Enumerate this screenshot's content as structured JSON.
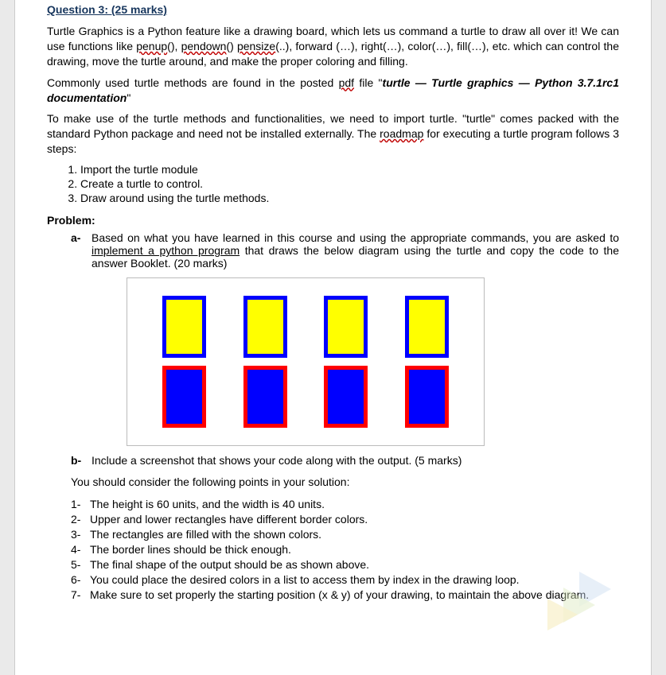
{
  "heading": "Question 3: (25 marks)",
  "para1_pre": "Turtle Graphics is a Python feature like a drawing board, which lets us command a turtle to draw all over it! We can use functions like ",
  "squig1": "penup",
  "para1_a": "(), ",
  "squig2": "pendown",
  "para1_b": "() ",
  "squig3": "pensize",
  "para1_c": "(..), forward (…), right(…), color(…), fill(…), etc. which can control the drawing, move the turtle around, and make the proper coloring and filling.",
  "para2_pre": "Commonly used turtle methods are found in the posted ",
  "squig4": "pdf",
  "para2_mid": " file \"",
  "para2_bold": "turtle — Turtle graphics — Python 3.7.1rc1 documentation",
  "para2_end": "\"",
  "para3_pre": "To make use of the turtle methods and functionalities, we need to import turtle. \"turtle\" comes packed with the standard Python package and need not be installed externally. The ",
  "squig5": "roadmap",
  "para3_end": " for executing a turtle program follows 3 steps:",
  "steps": [
    "Import the turtle module",
    "Create a turtle to control.",
    "Draw around using the turtle methods."
  ],
  "problem_label": "Problem:",
  "item_a_marker": "a-",
  "item_a_pre": "Based on what you have learned in this course and using the appropriate commands, you are asked to ",
  "item_a_underline": "implement a python program",
  "item_a_post": " that draws the below diagram using the turtle and copy the code to the answer Booklet. (20 marks)",
  "item_b_marker": "b-",
  "item_b": "Include a screenshot that shows your code along with the output. (5 marks)",
  "notes_intro": "You should consider the following points in your solution:",
  "notes": [
    "The height is 60 units, and the width is 40 units.",
    "Upper and lower rectangles have different border colors.",
    "The rectangles are filled with the shown colors.",
    "The border lines should be thick enough.",
    "The final shape of the output should be as shown above.",
    "You could place the desired colors in a list to access them by index in the drawing loop.",
    "Make sure to set properly the starting position (x & y) of your drawing, to maintain the above diagram."
  ],
  "diagram": {
    "top_row": {
      "count": 4,
      "fill": "#ffff00",
      "border": "#0000ff"
    },
    "bottom_row": {
      "count": 4,
      "fill": "#0000ff",
      "border": "#ff0000"
    },
    "width_units": 40,
    "height_units": 60
  }
}
